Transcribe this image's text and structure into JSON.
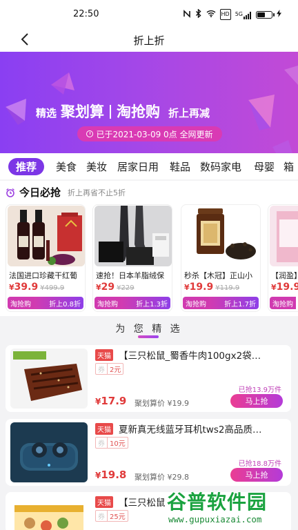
{
  "status_bar": {
    "time": "22:50",
    "icons": [
      "nfc-icon",
      "bluetooth-icon",
      "wifi-icon",
      "hd-icon",
      "signal-5g-icon",
      "battery-icon"
    ],
    "hd": "HD",
    "net": "5G"
  },
  "nav": {
    "title": "折上折"
  },
  "banner": {
    "prefix": "精选",
    "name1": "聚划算",
    "name2": "淘抢购",
    "suffix": "折上再减",
    "updated": "已于2021-03-09 0点 全网更新",
    "bg_colors": [
      "#8a3ff2",
      "#c24ad6"
    ]
  },
  "tabs": [
    "推荐",
    "美食",
    "美妆",
    "居家日用",
    "鞋品",
    "数码家电",
    "母婴",
    "箱"
  ],
  "today": {
    "title": "今日必抢",
    "subtitle": "折上再省不止5折",
    "cards": [
      {
        "title": "法国进口珍藏干红葡",
        "price": "39.9",
        "old_price": "499.9",
        "bar_left": "淘抢购",
        "bar_right": "折上0.8折"
      },
      {
        "title": "速抢！日本羊脂绒保",
        "price": "29",
        "old_price": "229",
        "bar_left": "淘抢购",
        "bar_right": "折上1.3折"
      },
      {
        "title": "秒杀【木冠】正山小",
        "price": "19.9",
        "old_price": "119.9",
        "bar_left": "淘抢购",
        "bar_right": "折上1.7折"
      },
      {
        "title": "【润盈】",
        "price": "19.9",
        "old_price": "",
        "bar_left": "淘抢购",
        "bar_right": ""
      }
    ]
  },
  "recommend": {
    "title": "为 您 精 选"
  },
  "products": [
    {
      "tag": "天猫",
      "title": "【三只松鼠_蜀香牛肉100gx2袋…",
      "coupon_label": "券",
      "coupon_value": "2元",
      "price": "17.9",
      "old": "聚划算价 ¥19.9",
      "sold": "已抢13.9万件",
      "button": "马上抢"
    },
    {
      "tag": "天猫",
      "title": "夏新真无线蓝牙耳机tws2高品质…",
      "coupon_label": "券",
      "coupon_value": "10元",
      "price": "19.8",
      "old": "聚划算价 ¥29.8",
      "sold": "已抢18.8万件",
      "button": "马上抢"
    },
    {
      "tag": "天猫",
      "title": "【三只松鼠",
      "coupon_label": "券",
      "coupon_value": "25元",
      "price": "",
      "old": "",
      "sold": "",
      "button": ""
    }
  ],
  "currency": "¥",
  "watermark": {
    "name": "谷普软件园",
    "url": "www.gupuxiazai.com"
  }
}
